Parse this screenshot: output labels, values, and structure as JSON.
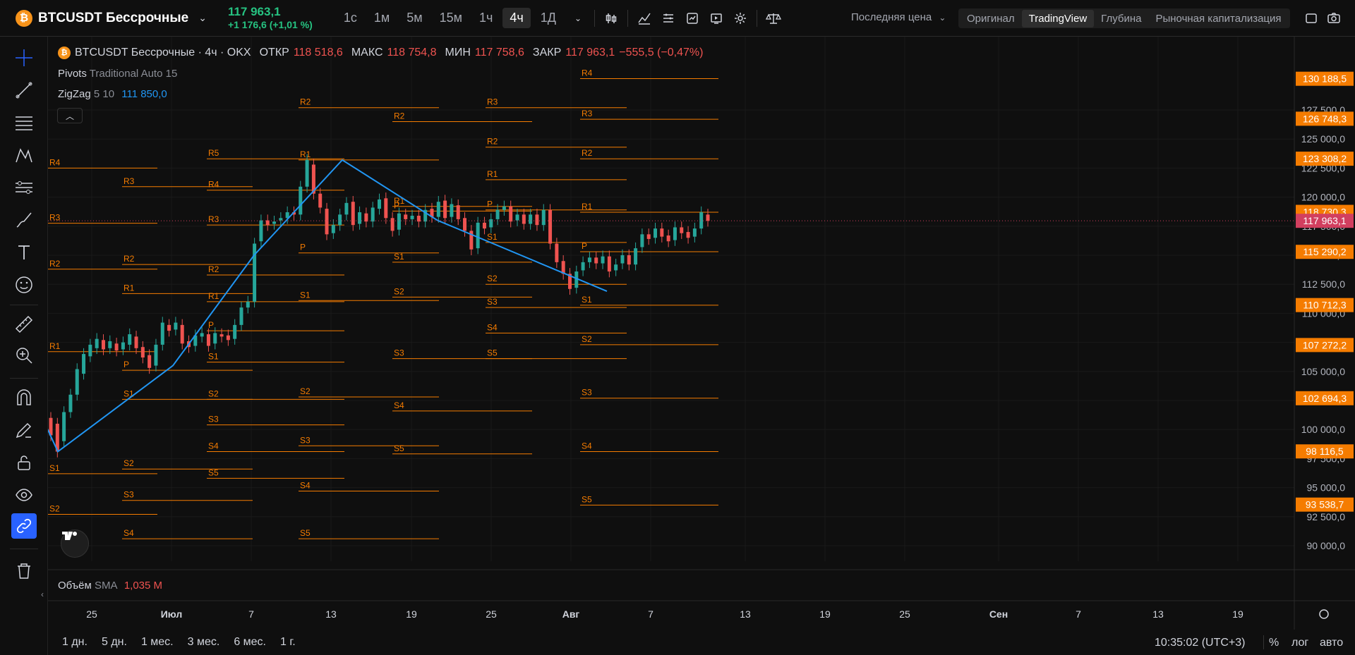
{
  "header": {
    "symbol_icon": "bitcoin-icon",
    "symbol": "BTCUSDT Бессрочные",
    "price": "117 963,1",
    "change": "+1 176,6 (+1,01 %)",
    "timeframes": [
      "1с",
      "1м",
      "5м",
      "15м",
      "1ч",
      "4ч",
      "1Д"
    ],
    "active_timeframe": "4ч",
    "price_type": "Последняя цена",
    "view_tabs": [
      "Оригинал",
      "TradingView",
      "Глубина",
      "Рыночная капитализация"
    ],
    "active_view": "TradingView"
  },
  "legend": {
    "title": "BTCUSDT Бессрочные · 4ч · OKX",
    "open_label": "ОТКР",
    "open": "118 518,6",
    "high_label": "МАКС",
    "high": "118 754,8",
    "low_label": "МИН",
    "low": "117 758,6",
    "close_label": "ЗАКР",
    "close": "117 963,1",
    "change": "−555,5 (−0,47%)"
  },
  "indicators": {
    "pivots_name": "Pivots",
    "pivots_params": "Traditional Auto 15",
    "zigzag_name": "ZigZag",
    "zigzag_params": "5 10",
    "zigzag_value": "111 850,0",
    "volume_name": "Объём",
    "volume_params": "SMA",
    "volume_value": "1,035 M"
  },
  "price_axis": {
    "ticks": [
      "127 500,0",
      "125 000,0",
      "122 500,0",
      "120 000,0",
      "117 500,0",
      "115 000,0",
      "112 500,0",
      "110 000,0",
      "107 500,0",
      "105 000,0",
      "102 500,0",
      "100 000,0",
      "97 500,0",
      "95 000,0",
      "92 500,0",
      "90 000,0"
    ],
    "tick_values": [
      127500,
      125000,
      122500,
      120000,
      117500,
      115000,
      112500,
      110000,
      107500,
      105000,
      102500,
      100000,
      97500,
      95000,
      92500,
      90000
    ],
    "pivot_labels": [
      "130 188,5",
      "126 748,3",
      "123 308,2",
      "118 730,3",
      "115 290,2",
      "110 712,3",
      "107 272,2",
      "102 694,3",
      "98 116,5",
      "93 538,7"
    ],
    "pivot_values": [
      130188.5,
      126748.3,
      123308.2,
      118730.3,
      115290.2,
      110712.3,
      107272.2,
      102694.3,
      98116.5,
      93538.7
    ],
    "current_label": "117 963,1",
    "current_value": 117963.1,
    "pivot_color": "#f57c00",
    "current_color": "#d23f5f"
  },
  "time_axis": {
    "labels": [
      "25",
      "Июл",
      "7",
      "13",
      "19",
      "25",
      "Авг",
      "7",
      "13",
      "19",
      "25",
      "Сен",
      "7",
      "13",
      "19"
    ],
    "bold_labels": [
      "Июл",
      "Авг",
      "Сен"
    ]
  },
  "zigzag": {
    "color": "#2196f3",
    "points": [
      [
        0,
        101000
      ],
      [
        1,
        98100
      ],
      [
        2,
        105500
      ],
      [
        3,
        115000
      ],
      [
        4,
        123200
      ],
      [
        5,
        118000
      ],
      [
        6,
        111900
      ]
    ]
  },
  "pivot_sets": [
    {
      "period": 0,
      "levels": [
        [
          "R4",
          122500
        ],
        [
          "R3",
          117750
        ],
        [
          "R2",
          113800
        ],
        [
          "R1",
          106700
        ],
        [
          "S1",
          96200
        ],
        [
          "S2",
          92700
        ]
      ]
    },
    {
      "period": 1,
      "levels": [
        [
          "R3",
          120900
        ],
        [
          "R2",
          114200
        ],
        [
          "R1",
          111700
        ],
        [
          "P",
          105100
        ],
        [
          "S1",
          102600
        ],
        [
          "S2",
          96600
        ],
        [
          "S3",
          93900
        ],
        [
          "S4",
          90600
        ]
      ]
    },
    {
      "period": 2,
      "levels": [
        [
          "R5",
          123300
        ],
        [
          "R4",
          120600
        ],
        [
          "R3",
          117600
        ],
        [
          "R2",
          113300
        ],
        [
          "R1",
          111000
        ],
        [
          "P",
          108500
        ],
        [
          "S1",
          105800
        ],
        [
          "S2",
          102600
        ],
        [
          "S3",
          100400
        ],
        [
          "S4",
          98100
        ],
        [
          "S5",
          95800
        ]
      ]
    },
    {
      "period": 3,
      "levels": [
        [
          "R2",
          127700
        ],
        [
          "R1",
          123200
        ],
        [
          "P",
          115200
        ],
        [
          "S1",
          111100
        ],
        [
          "S2",
          102800
        ],
        [
          "S3",
          98600
        ],
        [
          "S4",
          94700
        ],
        [
          "S5",
          90600
        ]
      ]
    },
    {
      "period": 4,
      "levels": [
        [
          "R2",
          126500
        ],
        [
          "R1",
          119200
        ],
        [
          "P",
          118800
        ],
        [
          "S1",
          114400
        ],
        [
          "S2",
          111400
        ],
        [
          "S3",
          106100
        ],
        [
          "S4",
          101600
        ],
        [
          "S5",
          97900
        ]
      ]
    },
    {
      "period": 5,
      "levels": [
        [
          "R3",
          127700
        ],
        [
          "R2",
          124300
        ],
        [
          "R1",
          121500
        ],
        [
          "P",
          118900
        ],
        [
          "S1",
          116100
        ],
        [
          "S2",
          112500
        ],
        [
          "S3",
          110500
        ],
        [
          "S4",
          108300
        ],
        [
          "S5",
          106100
        ]
      ]
    },
    {
      "period": 6,
      "levels": [
        [
          "R4",
          130200
        ],
        [
          "R3",
          126700
        ],
        [
          "R2",
          123300
        ],
        [
          "R1",
          118700
        ],
        [
          "P",
          115300
        ],
        [
          "S1",
          110700
        ],
        [
          "S2",
          107300
        ],
        [
          "S3",
          102700
        ],
        [
          "S4",
          98100
        ],
        [
          "S5",
          93500
        ]
      ]
    }
  ],
  "candles_path": [
    [
      101000,
      99500
    ],
    [
      100500,
      98100
    ],
    [
      99000,
      101500
    ],
    [
      101500,
      103000
    ],
    [
      103000,
      105200
    ],
    [
      104800,
      106500
    ],
    [
      106300,
      107300
    ],
    [
      107000,
      107800
    ],
    [
      107700,
      106900
    ],
    [
      107000,
      107600
    ],
    [
      107400,
      106800
    ],
    [
      106900,
      107500
    ],
    [
      107300,
      108200
    ],
    [
      108000,
      107000
    ],
    [
      107100,
      106200
    ],
    [
      106400,
      105300
    ],
    [
      105500,
      107300
    ],
    [
      107300,
      109200
    ],
    [
      109000,
      108500
    ],
    [
      108600,
      109200
    ],
    [
      109000,
      107400
    ],
    [
      107600,
      107100
    ],
    [
      107200,
      108100
    ],
    [
      108000,
      108300
    ],
    [
      108200,
      107200
    ],
    [
      107400,
      108300
    ],
    [
      108200,
      108000
    ],
    [
      108100,
      107700
    ],
    [
      107800,
      109000
    ],
    [
      109000,
      110500
    ],
    [
      110500,
      111000
    ],
    [
      111000,
      116000
    ],
    [
      116200,
      118000
    ],
    [
      118000,
      117600
    ],
    [
      117700,
      117900
    ],
    [
      118000,
      118200
    ],
    [
      118200,
      118700
    ],
    [
      118700,
      118500
    ],
    [
      118500,
      120900
    ],
    [
      120900,
      123200
    ],
    [
      122800,
      120300
    ],
    [
      120300,
      119100
    ],
    [
      119000,
      116800
    ],
    [
      116900,
      117600
    ],
    [
      117600,
      118500
    ],
    [
      118500,
      119500
    ],
    [
      119600,
      117600
    ],
    [
      117700,
      118700
    ],
    [
      118600,
      117900
    ],
    [
      117900,
      119100
    ],
    [
      119000,
      119800
    ],
    [
      119900,
      118200
    ],
    [
      118200,
      117100
    ],
    [
      117200,
      118600
    ],
    [
      118500,
      118100
    ],
    [
      118100,
      118400
    ],
    [
      118400,
      117900
    ],
    [
      117900,
      118900
    ],
    [
      119000,
      118300
    ],
    [
      118300,
      119600
    ],
    [
      119700,
      118200
    ],
    [
      118300,
      119400
    ],
    [
      119300,
      118100
    ],
    [
      118200,
      117100
    ],
    [
      117100,
      115500
    ],
    [
      115600,
      117800
    ],
    [
      117800,
      117300
    ],
    [
      117400,
      118100
    ],
    [
      118100,
      118900
    ],
    [
      118900,
      119200
    ],
    [
      119200,
      117900
    ],
    [
      118000,
      118500
    ],
    [
      118500,
      117700
    ],
    [
      117700,
      118500
    ],
    [
      118500,
      117600
    ],
    [
      117600,
      118900
    ],
    [
      118900,
      116000
    ],
    [
      116000,
      114400
    ],
    [
      114500,
      113400
    ],
    [
      113400,
      112100
    ],
    [
      112200,
      113600
    ],
    [
      113700,
      114400
    ],
    [
      114400,
      114800
    ],
    [
      114800,
      114300
    ],
    [
      114300,
      114900
    ],
    [
      114900,
      113600
    ],
    [
      113700,
      114200
    ],
    [
      114300,
      115000
    ],
    [
      115000,
      114200
    ],
    [
      114200,
      115600
    ],
    [
      115700,
      116800
    ],
    [
      116800,
      116400
    ],
    [
      116500,
      117300
    ],
    [
      117300,
      116600
    ],
    [
      116700,
      116200
    ],
    [
      116300,
      117400
    ],
    [
      117400,
      116900
    ],
    [
      117000,
      116500
    ],
    [
      116600,
      117300
    ],
    [
      117300,
      118700
    ],
    [
      118500,
      117963
    ]
  ]
}
